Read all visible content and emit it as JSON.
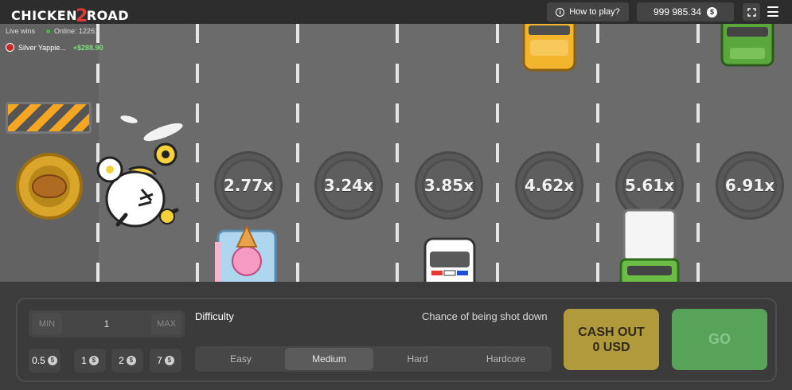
{
  "header": {
    "logo_left": "CHICKEN",
    "logo_mid": "2",
    "logo_right": "ROAD",
    "how_to_play": "How to play?",
    "balance": "999 985.34",
    "currency_symbol": "$"
  },
  "live": {
    "label": "Live wins",
    "online": "Online: 12261",
    "recent_winner": "Silver Yappie...",
    "recent_amount": "+$288.90"
  },
  "multipliers": [
    "2.77x",
    "3.24x",
    "3.85x",
    "4.62x",
    "5.61x",
    "6.91x"
  ],
  "bet": {
    "min_label": "MIN",
    "value": "1",
    "max_label": "MAX",
    "quick_amounts": [
      "0.5",
      "1",
      "2",
      "7"
    ]
  },
  "difficulty": {
    "label": "Difficulty",
    "chance_label": "Chance of being shot down",
    "options": [
      "Easy",
      "Medium",
      "Hard",
      "Hardcore"
    ],
    "selected": "Medium"
  },
  "actions": {
    "cashout_line1": "CASH OUT",
    "cashout_line2": "0 USD",
    "go_label": "GO"
  },
  "colors": {
    "road": "#6b6b6b",
    "cashout": "#b09a3c",
    "go": "#57a35a",
    "win_amount": "#7ee07e"
  }
}
